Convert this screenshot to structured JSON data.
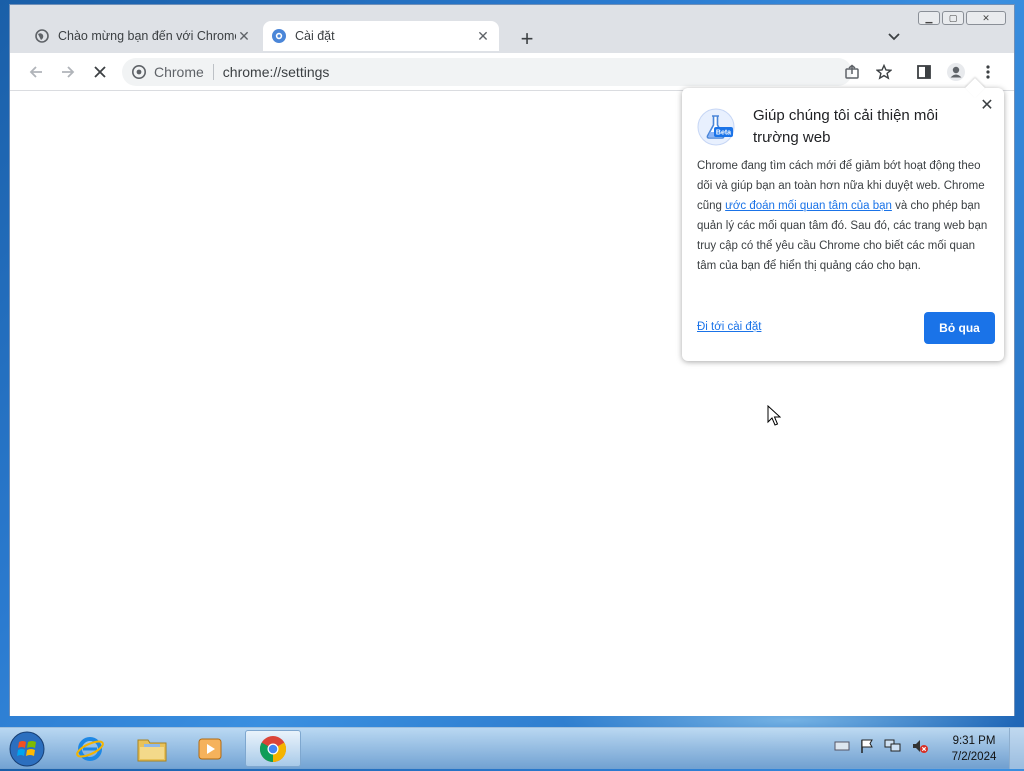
{
  "tabs": [
    {
      "label": "Chào mừng bạn đến với Chrome",
      "active": false,
      "favicon": "globe-icon"
    },
    {
      "label": "Cài đặt",
      "active": true,
      "favicon": "settings-gear-icon"
    }
  ],
  "toolbar": {
    "omnibox_chip": "Chrome",
    "url": "chrome://settings"
  },
  "promo": {
    "title": "Giúp chúng tôi cải thiện môi trường web",
    "body_before": "Chrome đang tìm cách mới để giảm bớt hoạt động theo dõi và giúp bạn an toàn hơn nữa khi duyệt web. Chrome cũng ",
    "body_link": "ước đoán mối quan tâm của bạn",
    "body_after": " và cho phép bạn quản lý các mối quan tâm đó. Sau đó, các trang web bạn truy cập có thể yêu cầu Chrome cho biết các mối quan tâm của bạn để hiển thị quảng cáo cho bạn.",
    "settings_link": "Đi tới cài đặt",
    "dismiss_button": "Bỏ qua",
    "badge": "Beta"
  },
  "taskbar": {
    "time": "9:31 PM",
    "date": "7/2/2024"
  },
  "colors": {
    "accent": "#1a73e8",
    "tabstrip": "#dee1e6"
  }
}
